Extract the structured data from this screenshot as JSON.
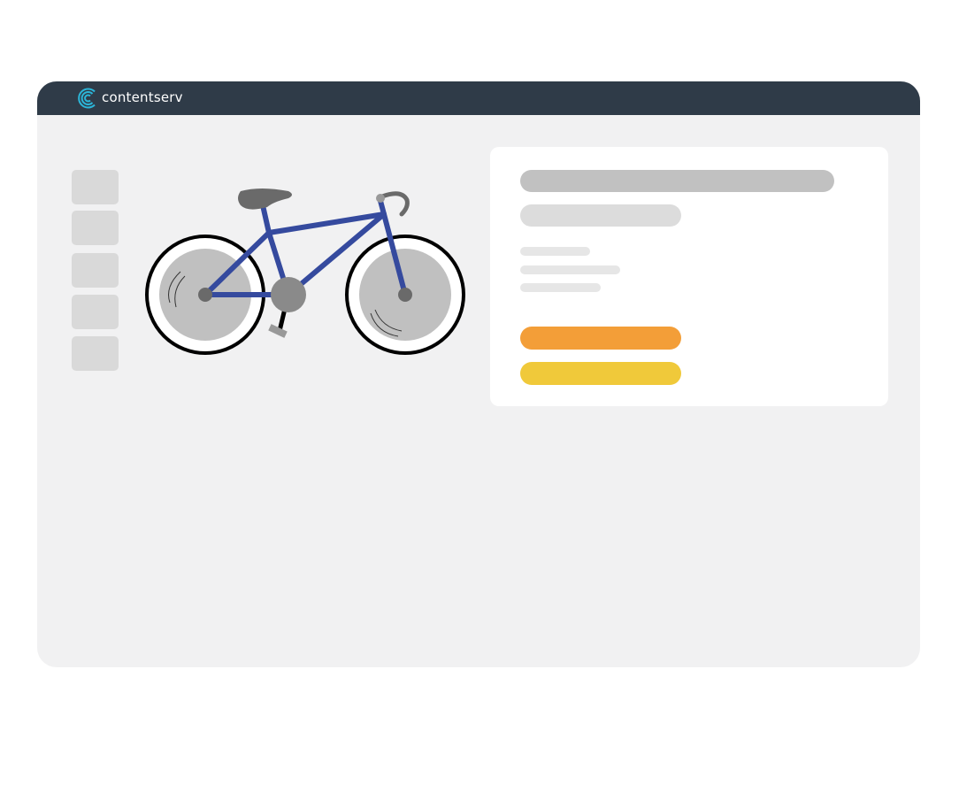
{
  "app": {
    "brand_name": "contentserv",
    "brand_color": "#2bb6d9",
    "titlebar_color": "#2f3b48"
  },
  "product": {
    "image": "bicycle",
    "frame_color": "#354a9e",
    "thumbnails": [
      "thumbnail-1",
      "thumbnail-2",
      "thumbnail-3",
      "thumbnail-4",
      "thumbnail-5"
    ]
  },
  "details": {
    "primary_button_color": "#f39e38",
    "secondary_button_color": "#f0c93a"
  }
}
